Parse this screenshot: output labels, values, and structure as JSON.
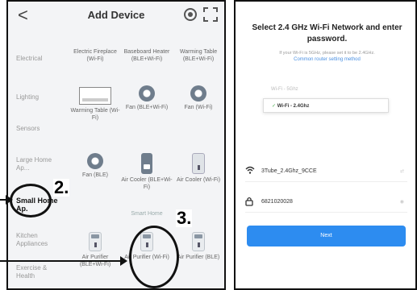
{
  "left": {
    "title": "Add Device",
    "back_glyph": "<",
    "categories": [
      {
        "label": "Electrical",
        "active": false
      },
      {
        "label": "Lighting",
        "active": false
      },
      {
        "label": "Sensors",
        "active": false
      },
      {
        "label": "Large Home Ap...",
        "active": false
      },
      {
        "label": "Small Home Ap.",
        "active": true
      },
      {
        "label": "Kitchen Appliances",
        "active": false
      },
      {
        "label": "Exercise & Health",
        "active": false
      }
    ],
    "devices": [
      {
        "label": "Electric Fireplace (Wi-Fi)",
        "icon": "heater-icon"
      },
      {
        "label": "Baseboard Heater (BLE+Wi-Fi)",
        "icon": "fan-icon"
      },
      {
        "label": "Warming Table (BLE+Wi-Fi)",
        "icon": "fan-icon"
      },
      {
        "label": "Warming Table (Wi-Fi)",
        "icon": "heater-icon"
      },
      {
        "label": "Fan (BLE+Wi-Fi)",
        "icon": "fan-icon"
      },
      {
        "label": "Fan (Wi-Fi)",
        "icon": "fan-icon"
      },
      {
        "label": "Fan (BLE)",
        "icon": "fan-icon"
      },
      {
        "label": "Air Cooler (BLE+Wi-Fi)",
        "icon": "tower-icon"
      },
      {
        "label": "Air Cooler (Wi-Fi)",
        "icon": "tower-icon"
      },
      {
        "label": "Air Purifier (BLE+Wi-Fi)",
        "icon": "purifier-icon"
      },
      {
        "label": "Air Purifier (Wi-Fi)",
        "icon": "purifier-icon"
      },
      {
        "label": "Air Purifier (BLE)",
        "icon": "purifier-icon"
      }
    ],
    "sub_label": "Smart Home",
    "step_2": "2.",
    "step_3": "3."
  },
  "right": {
    "title": "Select 2.4 GHz Wi-Fi Network and enter password.",
    "hint": "If your Wi-Fi is 5GHz, please set it to be 2.4GHz.",
    "hint_link": "Common router setting method",
    "wifi_rows": [
      {
        "label": "Wi-Fi - 5Ghz",
        "style": "dim"
      },
      {
        "label": "Wi-Fi - 2.4Ghz",
        "style": "highlight"
      },
      {
        "label": "",
        "style": "dim"
      },
      {
        "label": "",
        "style": "dim"
      }
    ],
    "ssid": "3Tube_2.4Ghz_9CCE",
    "password": "6821020028",
    "next_label": "Next"
  },
  "colors": {
    "accent": "#2d8cf0",
    "check": "#4caf50"
  }
}
